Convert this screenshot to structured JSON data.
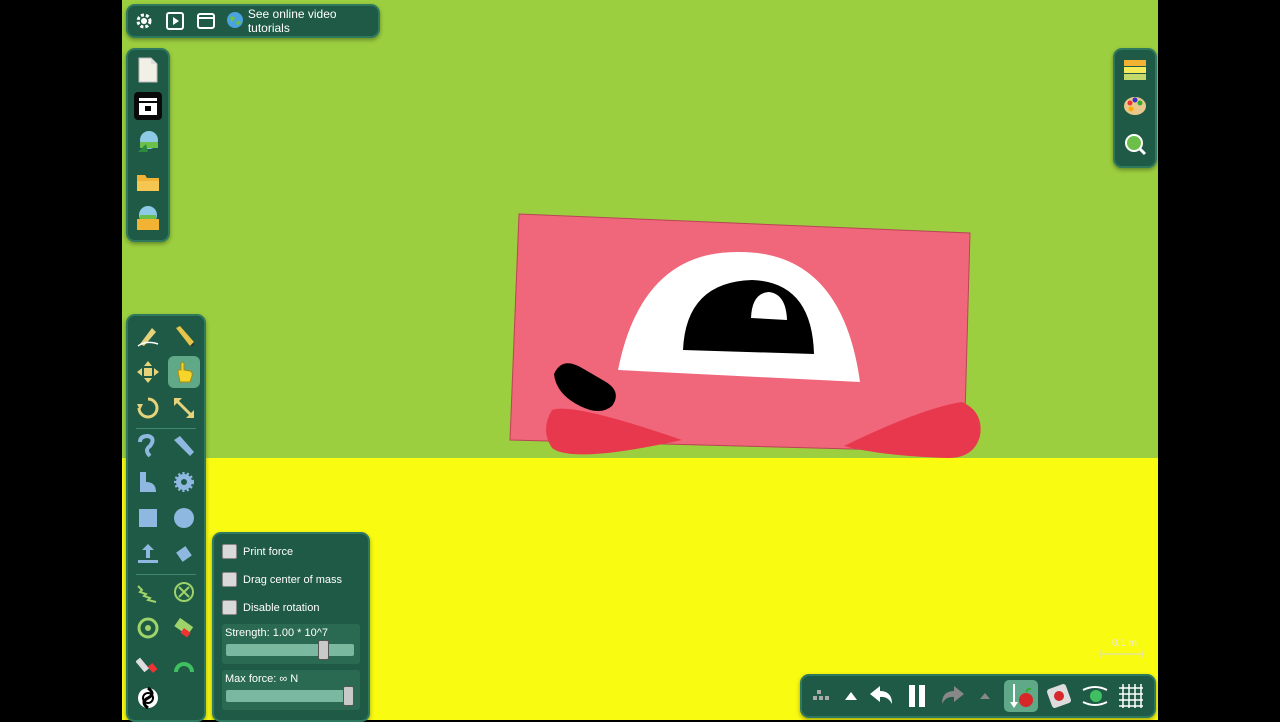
{
  "topbar": {
    "tutorial_label": "See online video tutorials",
    "icons": [
      "gear-icon",
      "play-icon",
      "window-icon",
      "globe-icon"
    ]
  },
  "file_panel": {
    "icons": [
      "new-file-icon",
      "archive-icon",
      "landscape-icon",
      "open-folder-icon",
      "folder-landscape-icon"
    ]
  },
  "right_panel": {
    "icons": [
      "layers-icon",
      "palette-icon",
      "zoom-icon"
    ]
  },
  "tools": {
    "active": "drag-tool",
    "icons": [
      "sketch-tool-icon",
      "pencil-tool-icon",
      "move-tool-icon",
      "drag-tool-icon",
      "rotate-tool-icon",
      "scale-tool-icon",
      "curve-tool-icon",
      "knife-tool-icon",
      "polygon-tool-icon",
      "gear-tool-icon",
      "box-tool-icon",
      "circle-tool-icon",
      "plane-tool-icon",
      "brush-tool-icon",
      "spring-tool-icon",
      "fixate-tool-icon",
      "hinge-tool-icon",
      "eraser-tool-icon",
      "laser-tool-icon",
      "tracer-tool-icon",
      "thruster-tool-icon"
    ]
  },
  "drag_options": {
    "print_force": "Print force",
    "drag_center_of_mass": "Drag center of mass",
    "disable_rotation": "Disable rotation",
    "strength_label": "Strength:  1.00 * 10^7",
    "strength_value": 0.79,
    "max_force_label": "Max force:  ∞  N",
    "max_force_value": 1.0
  },
  "bottombar": {
    "icons": [
      "grid-menu-icon",
      "arrow-up-icon",
      "undo-icon",
      "pause-icon",
      "redo-icon",
      "arrow-up-small-icon",
      "gravity-icon",
      "camera-follow-icon",
      "airflow-icon",
      "grid-icon"
    ]
  },
  "scale_label": "0.1 m",
  "colors": {
    "sky": "#9ccf3f",
    "ground": "#f9fb11",
    "panel": "#1e5a45",
    "body": "#f0667a",
    "cheek": "#e8384e"
  }
}
